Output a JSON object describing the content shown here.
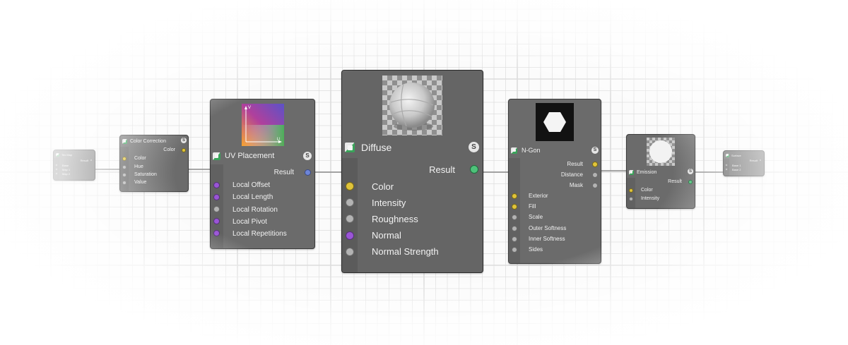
{
  "canvas": {
    "background": "#fbfbfb",
    "grid_color": "#dcdcdc",
    "link_color": "#8a8a8a"
  },
  "nodes": {
    "tex_map": {
      "title": "Tex Map",
      "result": "Result",
      "inputs": [
        "Base",
        "Map 1",
        "Map 2"
      ]
    },
    "color_correction": {
      "title": "Color Correction",
      "output": "Color",
      "inputs": [
        "Color",
        "Hue",
        "Saturation",
        "Value"
      ]
    },
    "uv_placement": {
      "title": "UV Placement",
      "axis_v": "V",
      "axis_u": "U",
      "result": "Result",
      "inputs": [
        "Local Offset",
        "Local Length",
        "Local Rotation",
        "Local Pivot",
        "Local Repetitions"
      ]
    },
    "diffuse": {
      "title": "Diffuse",
      "result": "Result",
      "inputs": [
        "Color",
        "Intensity",
        "Roughness",
        "Normal",
        "Normal Strength"
      ]
    },
    "n_gon": {
      "title": "N-Gon",
      "outputs": [
        "Result",
        "Distance",
        "Mask"
      ],
      "inputs": [
        "Exterior",
        "Fill",
        "Scale",
        "Outer Softness",
        "Inner Softness",
        "Sides"
      ]
    },
    "emission": {
      "title": "Emission",
      "result": "Result",
      "inputs": [
        "Color",
        "Intensity"
      ]
    },
    "output_node": {
      "title": "Surface",
      "result": "Result",
      "inputs": [
        "Base 1",
        "Base 2"
      ]
    }
  },
  "badge_letter": "S",
  "icons": {
    "node_type": "texture-icon",
    "badge": "s-badge-icon"
  },
  "port_colors": {
    "yellow": "#e0c43a",
    "gray": "#b3b3b3",
    "purple": "#9a55d6",
    "blue": "#6d85d8",
    "green": "#4ec27a"
  }
}
